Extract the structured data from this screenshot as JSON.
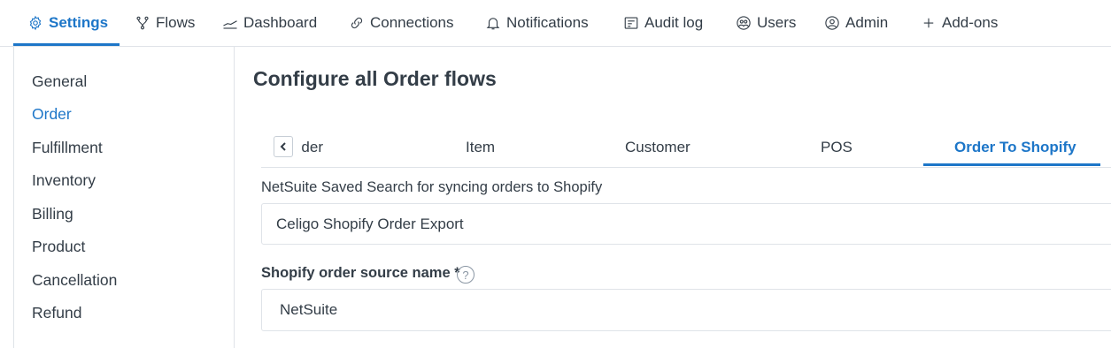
{
  "nav": {
    "items": [
      {
        "label": "Settings",
        "icon": "gear-icon",
        "active": true
      },
      {
        "label": "Flows",
        "icon": "flows-icon"
      },
      {
        "label": "Dashboard",
        "icon": "dashboard-icon"
      },
      {
        "label": "Connections",
        "icon": "link-icon"
      },
      {
        "label": "Notifications",
        "icon": "bell-icon"
      },
      {
        "label": "Audit log",
        "icon": "audit-log-icon"
      },
      {
        "label": "Users",
        "icon": "users-icon"
      },
      {
        "label": "Admin",
        "icon": "user-circle-icon"
      },
      {
        "label": "Add-ons",
        "icon": "plus-icon"
      }
    ]
  },
  "sidebar": {
    "items": [
      {
        "label": "General"
      },
      {
        "label": "Order",
        "active": true
      },
      {
        "label": "Fulfillment"
      },
      {
        "label": "Inventory"
      },
      {
        "label": "Billing"
      },
      {
        "label": "Product"
      },
      {
        "label": "Cancellation"
      },
      {
        "label": "Refund"
      }
    ]
  },
  "main": {
    "title": "Configure all Order flows",
    "tabs": [
      {
        "label": "Order"
      },
      {
        "label": "Item"
      },
      {
        "label": "Customer"
      },
      {
        "label": "POS"
      },
      {
        "label": "Order To Shopify",
        "active": true
      }
    ],
    "saved_search": {
      "label": "NetSuite Saved Search for syncing orders to Shopify",
      "value": "Celigo Shopify Order Export"
    },
    "source_name": {
      "label": "Shopify order source name *",
      "help": "?",
      "value": "NetSuite"
    }
  },
  "colors": {
    "accent": "#1d76c8",
    "text": "#333d47",
    "border": "#dfe3e8"
  }
}
